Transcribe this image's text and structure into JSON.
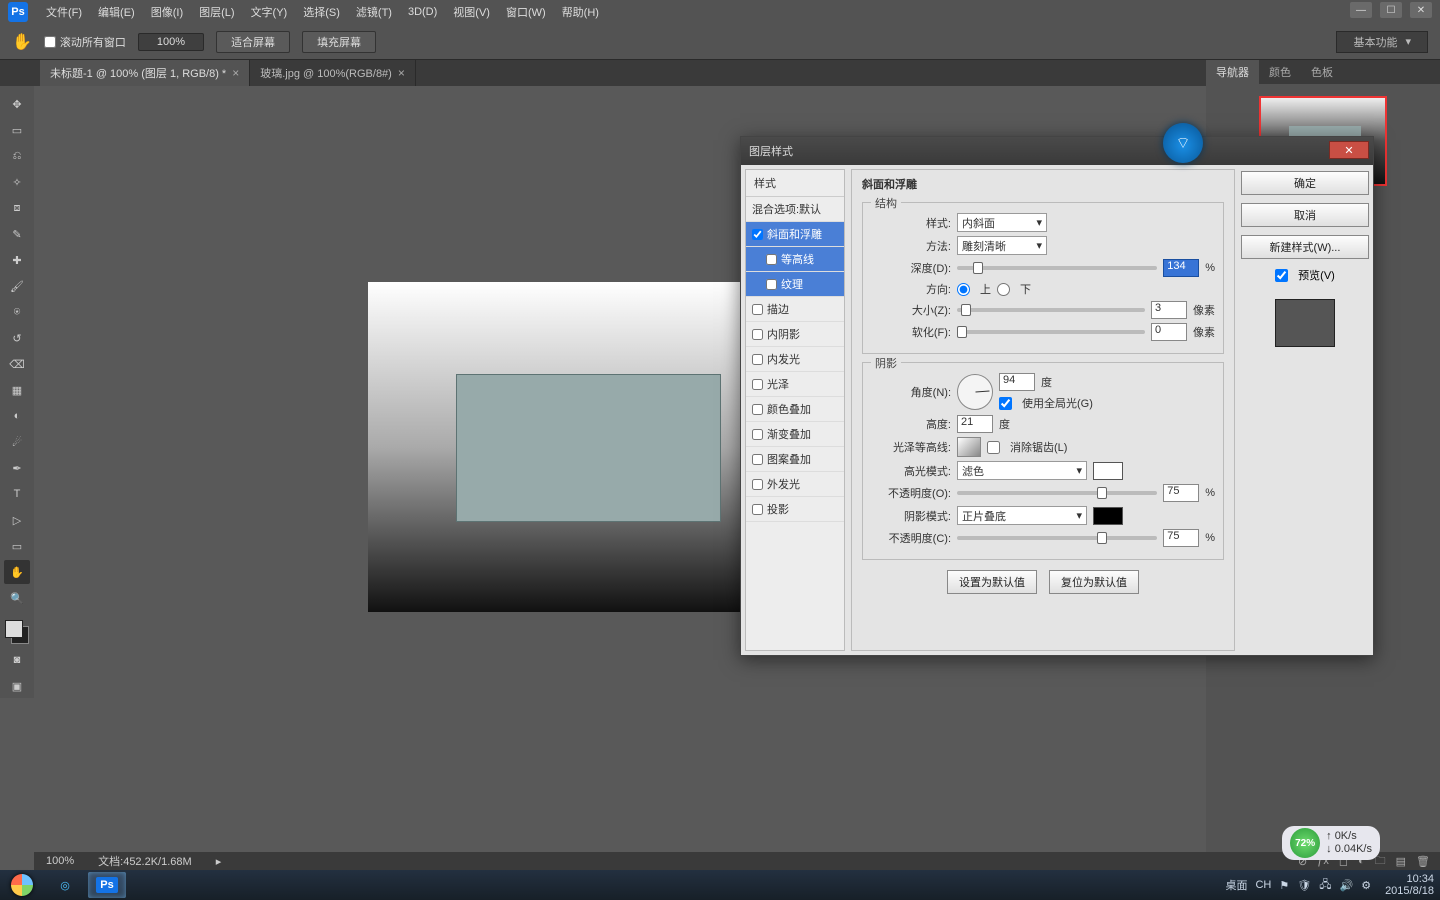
{
  "menubar": {
    "items": [
      "文件(F)",
      "编辑(E)",
      "图像(I)",
      "图层(L)",
      "文字(Y)",
      "选择(S)",
      "滤镜(T)",
      "3D(D)",
      "视图(V)",
      "窗口(W)",
      "帮助(H)"
    ],
    "logo": "Ps"
  },
  "options": {
    "scroll_all_windows": "滚动所有窗口",
    "zoom": "100%",
    "fit_screen": "适合屏幕",
    "fill_screen": "填充屏幕",
    "workspace": "基本功能"
  },
  "tabs": [
    {
      "label": "未标题-1 @ 100% (图层 1, RGB/8) *",
      "active": true
    },
    {
      "label": "玻璃.jpg @ 100%(RGB/8#)",
      "active": false
    }
  ],
  "right_panels": {
    "tabs": [
      "导航器",
      "颜色",
      "色板"
    ]
  },
  "dialog": {
    "title": "图层样式",
    "styles_header": "样式",
    "blend_options": "混合选项:默认",
    "style_list": [
      {
        "label": "斜面和浮雕",
        "checked": true,
        "selected": true
      },
      {
        "label": "等高线",
        "checked": false,
        "sub": true,
        "selected": true
      },
      {
        "label": "纹理",
        "checked": false,
        "sub": true,
        "selected": true
      },
      {
        "label": "描边",
        "checked": false
      },
      {
        "label": "内阴影",
        "checked": false
      },
      {
        "label": "内发光",
        "checked": false
      },
      {
        "label": "光泽",
        "checked": false
      },
      {
        "label": "颜色叠加",
        "checked": false
      },
      {
        "label": "渐变叠加",
        "checked": false
      },
      {
        "label": "图案叠加",
        "checked": false
      },
      {
        "label": "外发光",
        "checked": false
      },
      {
        "label": "投影",
        "checked": false
      }
    ],
    "bevel": {
      "title": "斜面和浮雕",
      "struct_title": "结构",
      "style_label": "样式:",
      "style_value": "内斜面",
      "method_label": "方法:",
      "method_value": "雕刻清晰",
      "depth_label": "深度(D):",
      "depth_value": "134",
      "depth_unit": "%",
      "direction_label": "方向:",
      "up": "上",
      "down": "下",
      "size_label": "大小(Z):",
      "size_value": "3",
      "size_unit": "像素",
      "soften_label": "软化(F):",
      "soften_value": "0",
      "soften_unit": "像素",
      "shadow_title": "阴影",
      "angle_label": "角度(N):",
      "angle_value": "94",
      "angle_unit": "度",
      "global_light": "使用全局光(G)",
      "altitude_label": "高度:",
      "altitude_value": "21",
      "altitude_unit": "度",
      "gloss_label": "光泽等高线:",
      "antialias": "消除锯齿(L)",
      "highlight_mode_label": "高光模式:",
      "highlight_mode_value": "滤色",
      "opacity_o_label": "不透明度(O):",
      "opacity_o_value": "75",
      "opacity_unit": "%",
      "shadow_mode_label": "阴影模式:",
      "shadow_mode_value": "正片叠底",
      "opacity_c_label": "不透明度(C):",
      "opacity_c_value": "75"
    },
    "buttons": {
      "ok": "确定",
      "cancel": "取消",
      "new_style": "新建样式(W)...",
      "preview": "预览(V)",
      "make_default": "设置为默认值",
      "reset_default": "复位为默认值"
    }
  },
  "status": {
    "zoom": "100%",
    "doc_info": "文档:452.2K/1.68M"
  },
  "speed": {
    "pct": "72%",
    "up": "0K/s",
    "down": "0.04K/s"
  },
  "tray": {
    "desktop": "桌面",
    "ime": "CH",
    "time": "10:34",
    "date": "2015/8/18"
  }
}
